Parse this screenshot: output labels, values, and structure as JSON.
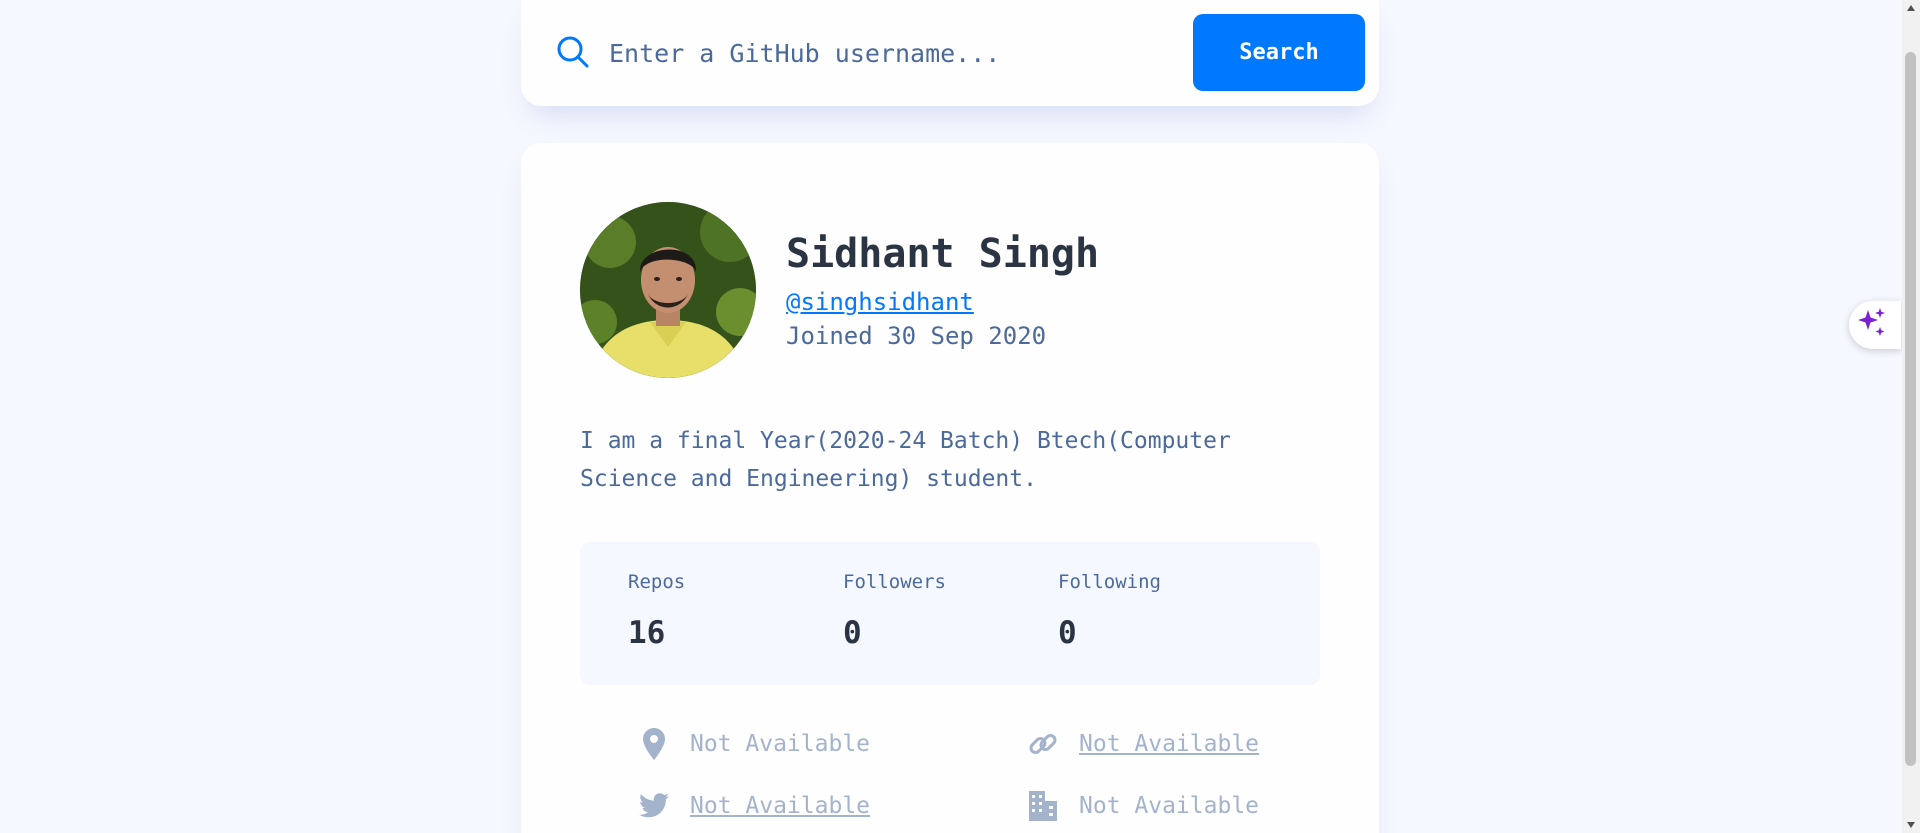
{
  "search": {
    "placeholder": "Enter a GitHub username...",
    "button_label": "Search"
  },
  "profile": {
    "name": "Sidhant Singh",
    "login": "@singhsidhant",
    "joined": "Joined 30 Sep 2020",
    "bio": "I am a final Year(2020-24 Batch) Btech(Computer Science and Engineering) student."
  },
  "stats": [
    {
      "label": "Repos",
      "value": "16"
    },
    {
      "label": "Followers",
      "value": "0"
    },
    {
      "label": "Following",
      "value": "0"
    }
  ],
  "info": {
    "location": "Not Available",
    "blog": "Not Available",
    "twitter": "Not Available",
    "company": "Not Available"
  },
  "icons": {
    "search": "search-icon",
    "location": "map-pin-icon",
    "blog": "link-icon",
    "twitter": "twitter-icon",
    "company": "building-icon",
    "ai": "sparkles-icon"
  },
  "colors": {
    "accent": "#0079ff",
    "background": "#f6f8ff",
    "card": "#fefefe",
    "text_dark": "#2b3442",
    "text_muted": "#4b6a9b",
    "text_unavailable": "#a4b3cc",
    "ai_icon": "#7b1fd1"
  }
}
